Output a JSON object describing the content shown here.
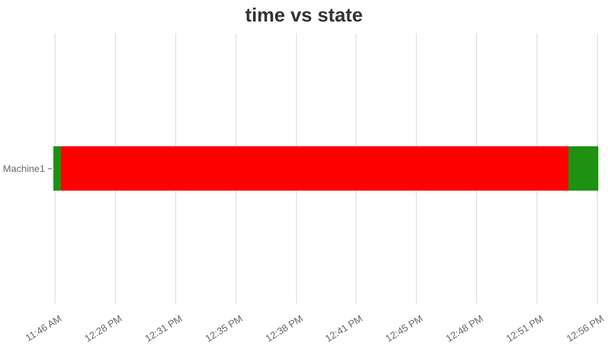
{
  "title": "time vs state",
  "chart_data": {
    "type": "bar",
    "layout": "timeline",
    "title": "time vs state",
    "ylabel": "",
    "xlabel": "",
    "x_ticks": [
      "11:46 AM",
      "12:28 PM",
      "12:31 PM",
      "12:35 PM",
      "12:38 PM",
      "12:41 PM",
      "12:45 PM",
      "12:48 PM",
      "12:51 PM",
      "12:56 PM"
    ],
    "x_tick_positions_pct": [
      0.5,
      11.5,
      22.5,
      33.5,
      44.5,
      55.5,
      66.5,
      77.5,
      88.5,
      99.5
    ],
    "categories": [
      "Machine1"
    ],
    "y_positions_pct": [
      50
    ],
    "series": [
      {
        "category": "Machine1",
        "segments": [
          {
            "state": "green",
            "color": "#1f9112",
            "start_pct": 0.3,
            "end_pct": 1.6
          },
          {
            "state": "red",
            "color": "#ff0000",
            "start_pct": 1.6,
            "end_pct": 94.3
          },
          {
            "state": "green",
            "color": "#1f9112",
            "start_pct": 94.3,
            "end_pct": 99.7
          }
        ]
      }
    ],
    "colors": {
      "green": "#1f9112",
      "red": "#ff0000"
    }
  }
}
